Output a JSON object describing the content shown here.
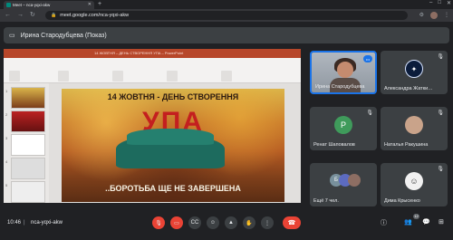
{
  "browser": {
    "tab_title": "Meet – nca-yqxi-akw",
    "new_tab_icon": "+",
    "url": "meet.google.com/nca-yqxi-akw",
    "window_controls": [
      "–",
      "□",
      "✕"
    ]
  },
  "presenting": {
    "label": "Ирина Стародубцева (Показ)"
  },
  "powerpoint": {
    "title": "14 ЖОВТНЯ – ДЕНЬ СТВОРЕННЯ УПА – PowerPoint",
    "thumbnails": [
      "1",
      "2",
      "3",
      "4",
      "5"
    ]
  },
  "slide": {
    "line1": "14 ЖОВТНЯ - ДЕНЬ СТВОРЕННЯ",
    "line2": "УПА",
    "line3": "..БОРОТЬБА ЩЕ НЕ ЗАВЕРШЕНА"
  },
  "participants": [
    {
      "name": "Ирина Стародубцева",
      "badge": "•••"
    },
    {
      "name": "Александра Жатки…"
    },
    {
      "name": "Ренат Шаповалов",
      "initial": "Р"
    },
    {
      "name": "Наталья Ракушина"
    },
    {
      "name": "Ещё 7 чел.",
      "initial": "Б"
    },
    {
      "name": "Дима Крысенко"
    }
  ],
  "bottom": {
    "time": "10:46",
    "meeting_code": "nca-yqxi-akw",
    "participant_count": "12"
  },
  "colors": {
    "accent": "#1a73e8",
    "end_call": "#ea4335",
    "ppt": "#b7472a",
    "avatar_green": "#3f9b5b"
  }
}
